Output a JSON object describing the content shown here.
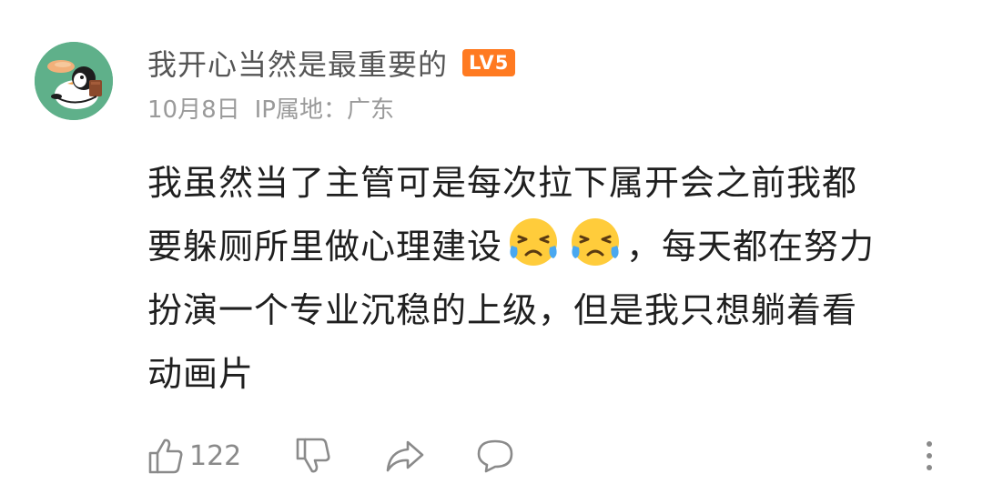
{
  "comment": {
    "username": "我开心当然是最重要的",
    "level_badge": "LV5",
    "date": "10月8日",
    "ip_location": "IP属地：广东",
    "content_lines": [
      "我虽然当了主管可是每次拉下属开会之前我都",
      "要躲厕所里做心理建设",
      "，每天都在努力",
      "扮演一个专业沉稳的上级，但是我只想躺着看",
      "动画片"
    ],
    "emojis": [
      "crying-laughing-emoji",
      "crying-laughing-emoji"
    ]
  },
  "actions": {
    "like_count": "122",
    "icons": [
      "thumbs-up-icon",
      "thumbs-down-icon",
      "share-icon",
      "reply-icon",
      "more-icon"
    ]
  },
  "colors": {
    "avatar_bg": "#5fb08a",
    "badge_bg": "#ff7a21",
    "text": "#1f1f1f",
    "meta": "#9a9a9a"
  }
}
